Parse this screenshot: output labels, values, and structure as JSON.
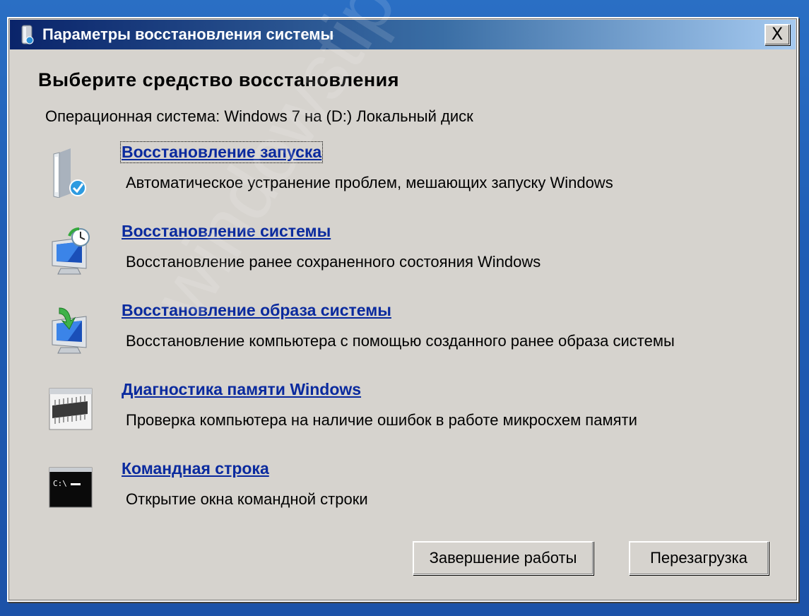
{
  "window": {
    "title": "Параметры восстановления системы",
    "close_label": "X"
  },
  "heading": "Выберите средство восстановления",
  "os_line": "Операционная система: Windows 7 на (D:) Локальный диск",
  "tools": [
    {
      "label": "Восстановление запуска",
      "description": "Автоматическое устранение проблем, мешающих запуску Windows",
      "icon": "startup-repair-icon"
    },
    {
      "label": "Восстановление системы",
      "description": "Восстановление ранее сохраненного состояния Windows",
      "icon": "system-restore-icon"
    },
    {
      "label": "Восстановление образа системы",
      "description": "Восстановление компьютера с помощью  созданного ранее образа системы",
      "icon": "system-image-recovery-icon"
    },
    {
      "label": "Диагностика памяти Windows",
      "description": "Проверка компьютера на наличие ошибок в работе микросхем памяти",
      "icon": "memory-diagnostic-icon"
    },
    {
      "label": "Командная строка",
      "description": "Открытие окна командной строки",
      "icon": "command-prompt-icon"
    }
  ],
  "buttons": {
    "shutdown": "Завершение работы",
    "restart": "Перезагрузка"
  },
  "watermark": "windowstips.ru",
  "colors": {
    "desktop": "#1f5db5",
    "title_bar_start": "#0a246a",
    "title_bar_end": "#a6caf0",
    "dialog_face": "#d6d3ce",
    "link": "#0a2a9e"
  }
}
